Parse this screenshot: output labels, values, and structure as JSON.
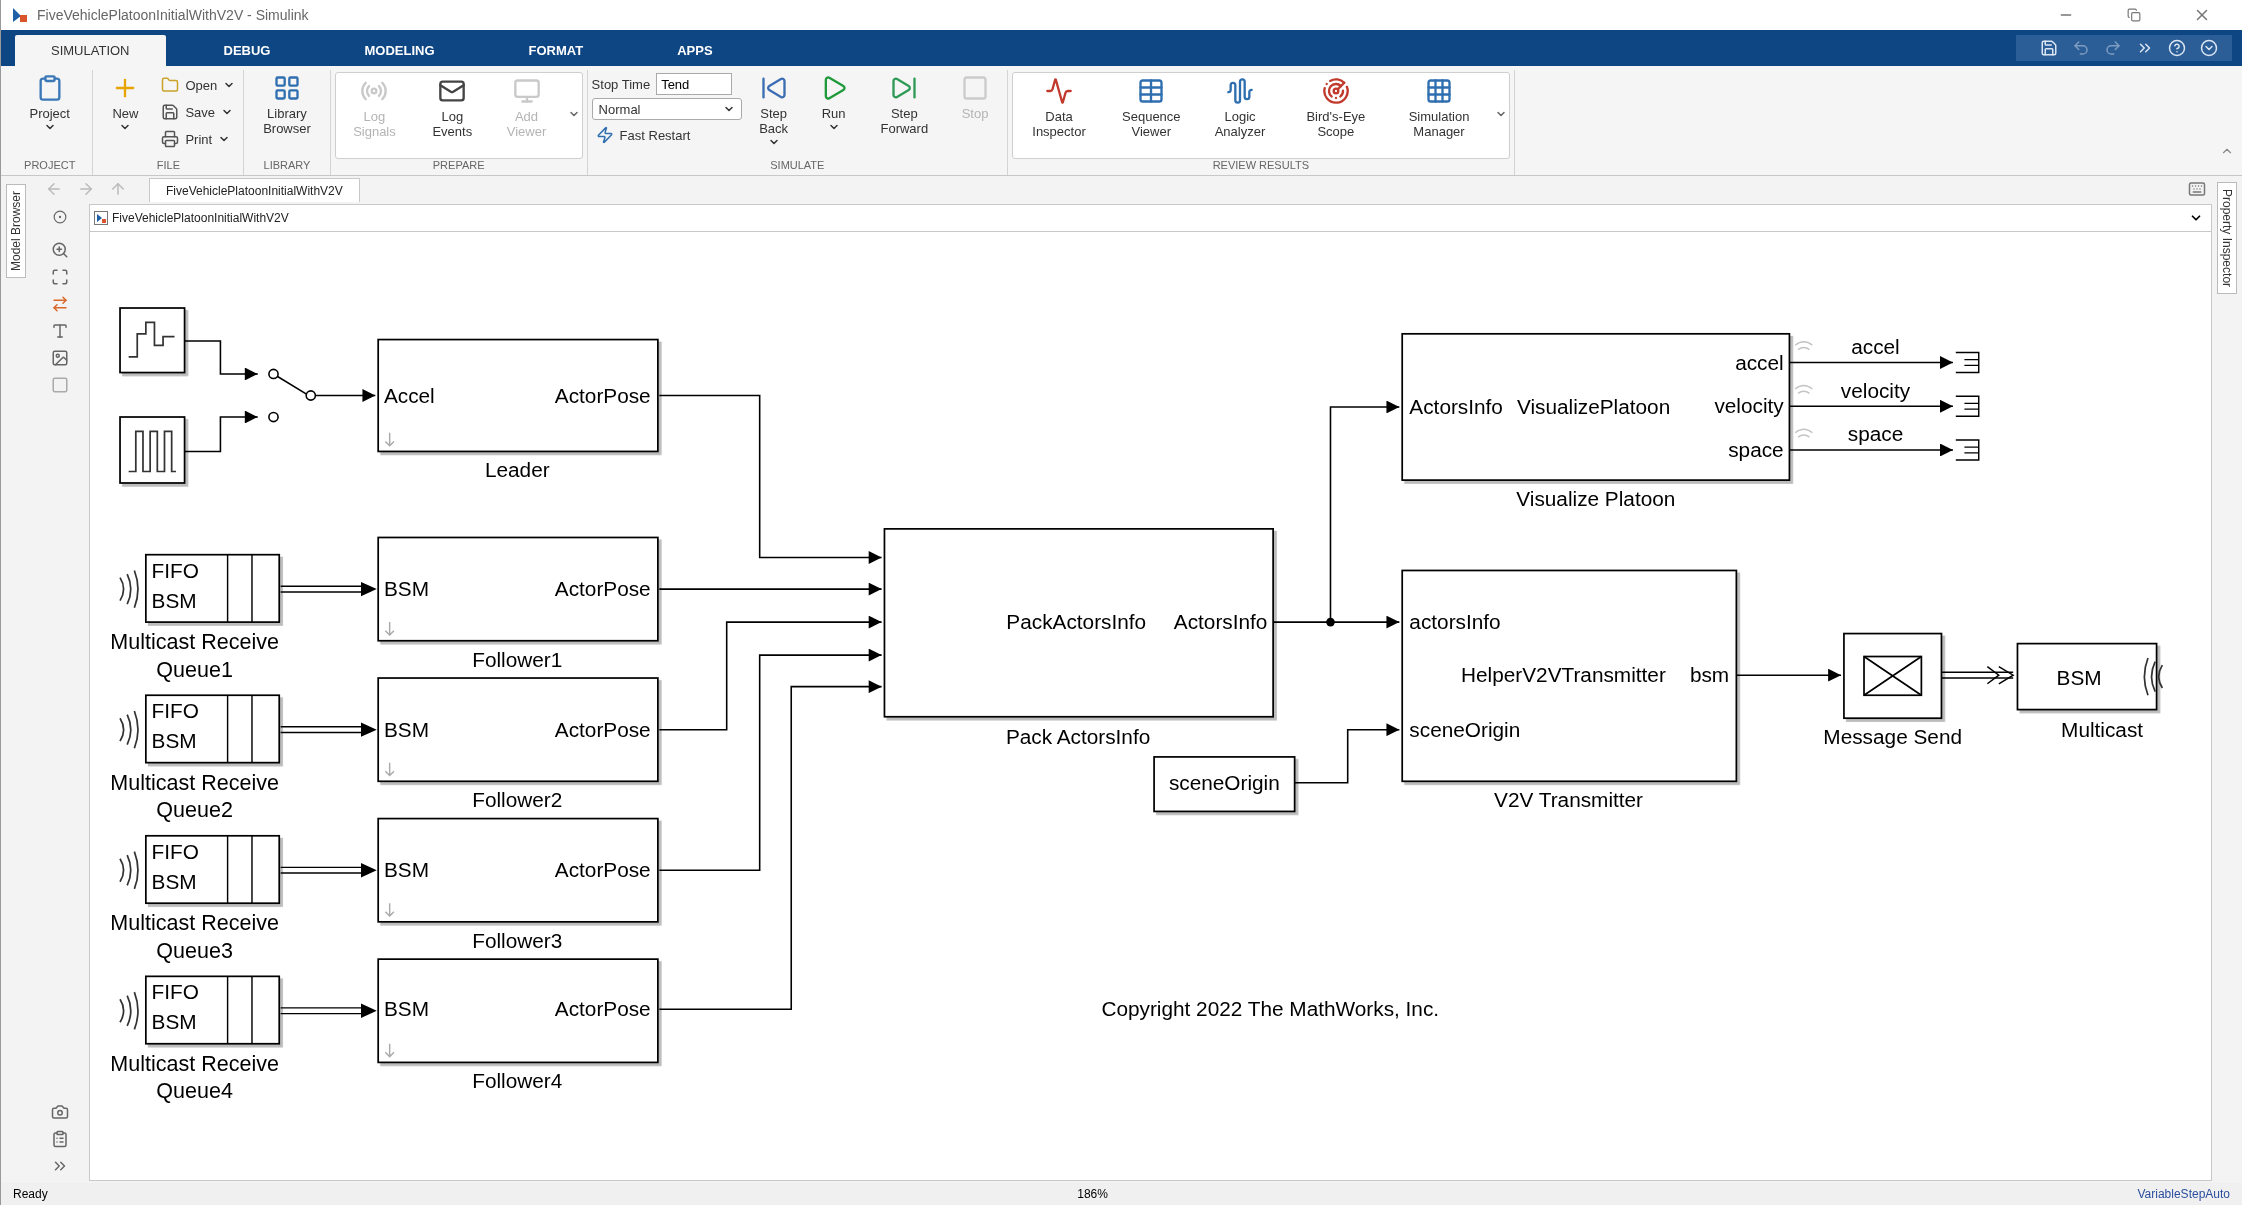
{
  "window": {
    "title": "FiveVehiclePlatoonInitialWithV2V - Simulink"
  },
  "ribbon_tabs": [
    {
      "label": "SIMULATION",
      "selected": true
    },
    {
      "label": "DEBUG",
      "selected": false
    },
    {
      "label": "MODELING",
      "selected": false
    },
    {
      "label": "FORMAT",
      "selected": false
    },
    {
      "label": "APPS",
      "selected": false
    }
  ],
  "ribbon_groups": [
    {
      "title": "PROJECT",
      "gallery": false,
      "items": [
        {
          "kind": "large",
          "label": "Project",
          "dropdown": true,
          "disabled": false
        }
      ]
    },
    {
      "title": "FILE",
      "gallery": false,
      "items": [
        {
          "kind": "large",
          "label": "New",
          "dropdown": true,
          "disabled": false
        },
        {
          "kind": "small",
          "label": "Open",
          "dropdown": true,
          "disabled": false
        },
        {
          "kind": "small",
          "label": "Save",
          "dropdown": true,
          "disabled": false
        },
        {
          "kind": "small",
          "label": "Print",
          "dropdown": true,
          "disabled": false
        }
      ]
    },
    {
      "title": "LIBRARY",
      "gallery": false,
      "items": [
        {
          "kind": "large",
          "label": "Library Browser",
          "dropdown": false,
          "disabled": false
        }
      ]
    },
    {
      "title": "PREPARE",
      "gallery": true,
      "items": [
        {
          "kind": "large",
          "label": "Log Signals",
          "dropdown": false,
          "disabled": true
        },
        {
          "kind": "large",
          "label": "Log Events",
          "dropdown": false,
          "disabled": false
        },
        {
          "kind": "large",
          "label": "Add Viewer",
          "dropdown": false,
          "disabled": true
        }
      ]
    },
    {
      "title": "SIMULATE",
      "gallery": false,
      "items": [
        {
          "kind": "field",
          "label": "Stop Time",
          "value": "Tend"
        },
        {
          "kind": "select",
          "value": "Normal"
        },
        {
          "kind": "toggle",
          "label": "Fast Restart"
        },
        {
          "kind": "large",
          "label": "Step Back",
          "dropdown": true,
          "disabled": false
        },
        {
          "kind": "large",
          "label": "Run",
          "dropdown": true,
          "disabled": false
        },
        {
          "kind": "large",
          "label": "Step Forward",
          "dropdown": false,
          "disabled": false
        },
        {
          "kind": "large",
          "label": "Stop",
          "dropdown": false,
          "disabled": true
        }
      ]
    },
    {
      "title": "REVIEW RESULTS",
      "gallery": true,
      "items": [
        {
          "kind": "large",
          "label": "Data Inspector",
          "dropdown": false,
          "disabled": false
        },
        {
          "kind": "large",
          "label": "Sequence Viewer",
          "dropdown": false,
          "disabled": false
        },
        {
          "kind": "large",
          "label": "Logic Analyzer",
          "dropdown": false,
          "disabled": false
        },
        {
          "kind": "large",
          "label": "Bird's-Eye Scope",
          "dropdown": false,
          "disabled": false
        },
        {
          "kind": "large",
          "label": "Simulation Manager",
          "dropdown": false,
          "disabled": false
        }
      ]
    }
  ],
  "side_tabs": {
    "left": "Model Browser",
    "right": "Property Inspector"
  },
  "breadcrumb_tab": "FiveVehiclePlatoonInitialWithV2V",
  "address": "FiveVehiclePlatoonInitialWithV2V",
  "diagram": {
    "subsystems": [
      {
        "input": "Accel",
        "output": "ActorPose",
        "name": "Leader"
      },
      {
        "input": "BSM",
        "output": "ActorPose",
        "name": "Follower1"
      },
      {
        "input": "BSM",
        "output": "ActorPose",
        "name": "Follower2"
      },
      {
        "input": "BSM",
        "output": "ActorPose",
        "name": "Follower3"
      },
      {
        "input": "BSM",
        "output": "ActorPose",
        "name": "Follower4"
      }
    ],
    "queues": [
      {
        "top": "FIFO",
        "bottom": "BSM",
        "name": "Multicast Receive Queue1"
      },
      {
        "top": "FIFO",
        "bottom": "BSM",
        "name": "Multicast Receive Queue2"
      },
      {
        "top": "FIFO",
        "bottom": "BSM",
        "name": "Multicast Receive Queue3"
      },
      {
        "top": "FIFO",
        "bottom": "BSM",
        "name": "Multicast Receive Queue4"
      }
    ],
    "switch_inputs": [
      {
        "selected": true
      },
      {
        "selected": false
      }
    ],
    "pack": {
      "text": "PackActorsInfo",
      "output": "ActorsInfo",
      "name": "Pack ActorsInfo"
    },
    "visualize": {
      "input": "ActorsInfo",
      "text": "VisualizePlatoon",
      "outputs": [
        "accel",
        "velocity",
        "space"
      ],
      "signals": [
        "accel",
        "velocity",
        "space"
      ],
      "name": "Visualize Platoon"
    },
    "transmitter": {
      "inputs": [
        "actorsInfo",
        "sceneOrigin"
      ],
      "text": "HelperV2VTransmitter",
      "output": "bsm",
      "name": "V2V Transmitter"
    },
    "constant": "sceneOrigin",
    "message_send": "Message Send",
    "multicast": {
      "text": "BSM",
      "name": "Multicast"
    },
    "annotation": "Copyright 2022 The MathWorks, Inc."
  },
  "status_bar": {
    "state": "Ready",
    "zoom": "186%",
    "solver": "VariableStepAuto"
  }
}
